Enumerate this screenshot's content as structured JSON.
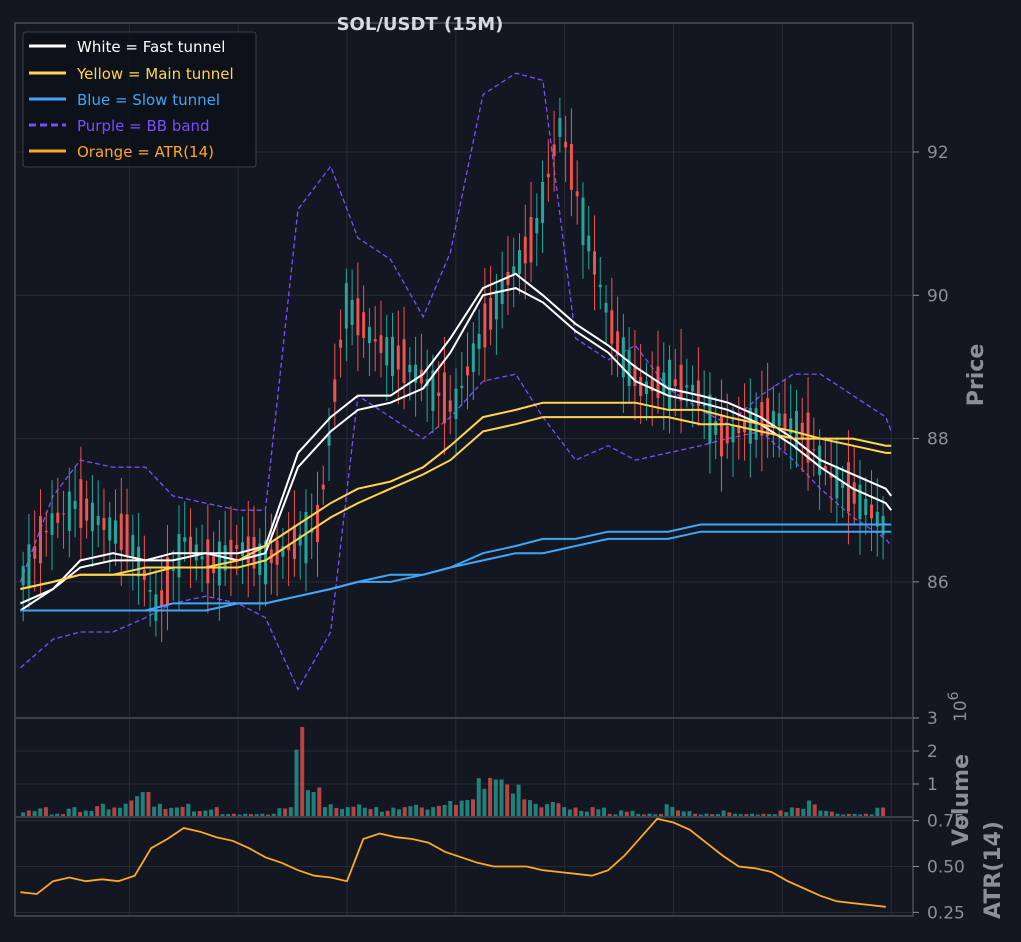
{
  "colors": {
    "background": "#131722",
    "frame": "#3a3f4b",
    "grid": "#262b36",
    "tick_text": "#8a8f99",
    "up": "#26a69a",
    "down": "#ef5350",
    "fast": "#ffffff",
    "main": "#ffd54f",
    "slow": "#42a5f5",
    "bb": "#7c4dff",
    "atr": "#ffa726"
  },
  "chart_data": [
    {
      "panel": "price",
      "type": "line",
      "title": "SOL/USDT (15M)",
      "ylabel": "Price",
      "ylim": [
        84.1,
        93.8
      ],
      "yticks": [
        86,
        88,
        90,
        92
      ],
      "ytick_labels": [
        "86",
        "88",
        "90",
        "92"
      ],
      "x": [
        0,
        6,
        11,
        17,
        23,
        28,
        34,
        40,
        45,
        51,
        57,
        62,
        68,
        74,
        79,
        85,
        91,
        96,
        102,
        108,
        113,
        119,
        125,
        130,
        136,
        142,
        147,
        153,
        159,
        160
      ],
      "candles_ohlc": [
        [
          85.6,
          86.3,
          85.5,
          86.1
        ],
        [
          86.1,
          87.0,
          85.9,
          86.8
        ],
        [
          86.8,
          87.3,
          86.5,
          87.1
        ],
        [
          87.1,
          87.3,
          86.6,
          86.8
        ],
        [
          86.8,
          87.2,
          86.2,
          86.6
        ],
        [
          86.6,
          86.8,
          85.2,
          85.6
        ],
        [
          85.6,
          86.9,
          85.4,
          86.6
        ],
        [
          86.6,
          86.9,
          85.9,
          86.2
        ],
        [
          86.2,
          86.9,
          85.8,
          86.5
        ],
        [
          86.5,
          86.9,
          86.0,
          86.3
        ],
        [
          86.3,
          86.8,
          86.2,
          86.5
        ],
        [
          86.5,
          87.0,
          86.3,
          86.8
        ],
        [
          86.8,
          90.7,
          86.7,
          89.9
        ],
        [
          89.9,
          90.6,
          89.0,
          89.4
        ],
        [
          89.4,
          89.8,
          88.7,
          89.1
        ],
        [
          89.1,
          89.4,
          88.5,
          88.8
        ],
        [
          88.8,
          89.1,
          88.1,
          88.4
        ],
        [
          88.4,
          89.7,
          88.3,
          89.4
        ],
        [
          89.4,
          90.4,
          89.2,
          90.2
        ],
        [
          90.2,
          91.2,
          90.0,
          90.8
        ],
        [
          90.8,
          92.7,
          90.6,
          92.4
        ],
        [
          92.4,
          93.4,
          90.3,
          90.8
        ],
        [
          90.8,
          91.2,
          89.0,
          89.4
        ],
        [
          89.4,
          89.6,
          88.4,
          88.7
        ],
        [
          88.7,
          89.1,
          88.2,
          88.8
        ],
        [
          88.8,
          89.0,
          88.4,
          88.7
        ],
        [
          88.7,
          89.2,
          87.6,
          88.0
        ],
        [
          88.0,
          88.4,
          87.7,
          88.2
        ],
        [
          88.2,
          88.8,
          87.8,
          88.3
        ],
        [
          88.3,
          88.6,
          87.9,
          88.1
        ],
        [
          88.1,
          88.5,
          87.2,
          87.5
        ],
        [
          87.5,
          87.7,
          86.9,
          87.2
        ],
        [
          87.2,
          87.4,
          86.7,
          86.8
        ]
      ],
      "series": [
        {
          "name": "White = Fast tunnel",
          "color": "#ffffff",
          "values": [
            85.7,
            85.9,
            86.3,
            86.4,
            86.3,
            86.4,
            86.4,
            86.4,
            86.5,
            87.8,
            88.3,
            88.6,
            88.6,
            88.9,
            89.4,
            90.1,
            90.3,
            90.0,
            89.6,
            89.3,
            89.0,
            88.7,
            88.6,
            88.5,
            88.3,
            88.0,
            87.7,
            87.5,
            87.3,
            87.2
          ],
          "values_2": [
            85.6,
            85.9,
            86.2,
            86.3,
            86.3,
            86.3,
            86.4,
            86.3,
            86.4,
            87.6,
            88.1,
            88.4,
            88.5,
            88.7,
            89.2,
            90.0,
            90.1,
            89.9,
            89.5,
            89.2,
            88.8,
            88.6,
            88.5,
            88.4,
            88.2,
            87.9,
            87.6,
            87.3,
            87.1,
            87.0
          ]
        },
        {
          "name": "Yellow = Main tunnel",
          "color": "#ffd54f",
          "values": [
            85.9,
            86.0,
            86.1,
            86.1,
            86.2,
            86.2,
            86.2,
            86.3,
            86.5,
            86.8,
            87.1,
            87.3,
            87.4,
            87.6,
            87.9,
            88.3,
            88.4,
            88.5,
            88.5,
            88.5,
            88.5,
            88.4,
            88.4,
            88.3,
            88.2,
            88.1,
            88.0,
            88.0,
            87.9,
            87.9
          ],
          "values_2": [
            85.9,
            86.0,
            86.1,
            86.1,
            86.1,
            86.2,
            86.2,
            86.2,
            86.3,
            86.6,
            86.9,
            87.1,
            87.3,
            87.5,
            87.7,
            88.1,
            88.2,
            88.3,
            88.3,
            88.3,
            88.3,
            88.3,
            88.2,
            88.2,
            88.1,
            88.0,
            88.0,
            87.9,
            87.8,
            87.8
          ]
        },
        {
          "name": "Blue = Slow tunnel",
          "color": "#42a5f5",
          "values": [
            85.6,
            85.6,
            85.6,
            85.6,
            85.6,
            85.7,
            85.7,
            85.7,
            85.7,
            85.8,
            85.9,
            86.0,
            86.1,
            86.1,
            86.2,
            86.4,
            86.5,
            86.6,
            86.6,
            86.7,
            86.7,
            86.7,
            86.8,
            86.8,
            86.8,
            86.8,
            86.8,
            86.8,
            86.8,
            86.8
          ],
          "values_2": [
            85.6,
            85.6,
            85.6,
            85.6,
            85.6,
            85.6,
            85.6,
            85.7,
            85.7,
            85.8,
            85.9,
            86.0,
            86.0,
            86.1,
            86.2,
            86.3,
            86.4,
            86.4,
            86.5,
            86.6,
            86.6,
            86.6,
            86.7,
            86.7,
            86.7,
            86.7,
            86.7,
            86.7,
            86.7,
            86.7
          ]
        },
        {
          "name": "Purple = BB band",
          "color": "#7c4dff",
          "dashed": true,
          "values": [
            86.0,
            87.2,
            87.7,
            87.6,
            87.6,
            87.2,
            87.1,
            87.0,
            87.0,
            91.2,
            91.8,
            90.8,
            90.5,
            89.7,
            90.6,
            92.8,
            93.1,
            93.0,
            89.4,
            89.1,
            89.3,
            88.7,
            88.4,
            88.2,
            88.6,
            88.9,
            88.9,
            88.6,
            88.3,
            88.1
          ],
          "values_2": [
            84.8,
            85.2,
            85.3,
            85.3,
            85.5,
            85.7,
            85.8,
            85.7,
            85.5,
            84.5,
            85.3,
            88.6,
            88.3,
            88.0,
            88.3,
            88.8,
            88.9,
            88.3,
            87.7,
            87.9,
            87.7,
            87.8,
            87.9,
            88.0,
            88.1,
            87.7,
            87.3,
            86.9,
            86.6,
            86.5
          ]
        },
        {
          "name": "Orange = ATR(14)",
          "color": "#ffa726",
          "legend_only": true,
          "values": []
        }
      ],
      "legend_placement": "top-left",
      "grid": true
    },
    {
      "panel": "volume",
      "type": "bar",
      "ylabel": "Volume",
      "scale_label": "10^6",
      "ylim": [
        0,
        3.0
      ],
      "yticks": [
        1,
        2,
        3
      ],
      "ytick_labels": [
        "1",
        "2",
        "3"
      ],
      "values": [
        0.2,
        0.3,
        0.1,
        0.3,
        0.2,
        0.4,
        0.3,
        0.5,
        0.8,
        0.4,
        0.3,
        0.4,
        0.2,
        0.3,
        0.1,
        0.1,
        0.1,
        0.1,
        0.3,
        2.8,
        0.9,
        0.4,
        0.3,
        0.4,
        0.3,
        0.2,
        0.3,
        0.4,
        0.3,
        0.4,
        0.5,
        0.6,
        1.2,
        1.3,
        1.0,
        0.6,
        0.4,
        0.5,
        0.3,
        0.2,
        0.3,
        0.1,
        0.2,
        0.1,
        0.1,
        0.4,
        0.2,
        0.1,
        0.1,
        0.2,
        0.1,
        0.1,
        0.1,
        0.2,
        0.3,
        0.5,
        0.2,
        0.1,
        0.1,
        0.1,
        0.3
      ]
    },
    {
      "panel": "atr",
      "type": "line",
      "ylabel": "ATR(14)",
      "ylim": [
        0.23,
        0.77
      ],
      "yticks": [
        0.25,
        0.5,
        0.75
      ],
      "ytick_labels": [
        "0.25",
        "0.50",
        "0.75"
      ],
      "x": [
        0,
        3,
        6,
        9,
        12,
        15,
        18,
        21,
        24,
        27,
        30,
        33,
        36,
        39,
        42,
        45,
        48,
        51,
        54,
        57,
        60,
        63,
        66,
        69,
        72,
        75,
        78,
        81,
        84,
        87,
        90,
        93,
        96,
        99,
        102,
        105,
        108,
        111,
        114,
        117,
        120,
        123,
        126,
        129,
        132,
        135,
        138,
        141,
        144,
        147,
        150,
        153,
        156,
        159
      ],
      "values": [
        0.36,
        0.35,
        0.42,
        0.44,
        0.42,
        0.43,
        0.42,
        0.45,
        0.6,
        0.65,
        0.71,
        0.69,
        0.66,
        0.64,
        0.6,
        0.55,
        0.52,
        0.48,
        0.45,
        0.44,
        0.42,
        0.65,
        0.68,
        0.66,
        0.65,
        0.63,
        0.58,
        0.55,
        0.52,
        0.5,
        0.5,
        0.5,
        0.48,
        0.47,
        0.46,
        0.45,
        0.48,
        0.56,
        0.66,
        0.76,
        0.74,
        0.7,
        0.63,
        0.56,
        0.5,
        0.49,
        0.47,
        0.42,
        0.38,
        0.34,
        0.31,
        0.3,
        0.29,
        0.28
      ]
    }
  ],
  "x_range": [
    -1,
    164
  ],
  "x_gridlines": [
    20,
    40,
    60,
    80,
    100,
    120,
    140,
    160
  ]
}
